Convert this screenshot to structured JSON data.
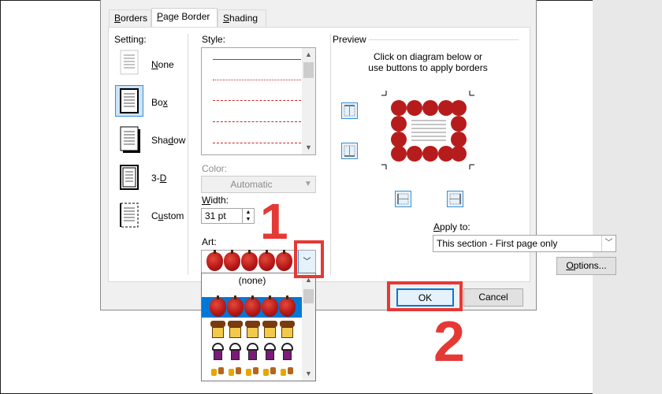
{
  "tabs": [
    {
      "label": "Borders",
      "underline": "B",
      "rest": "orders"
    },
    {
      "label": "Page Border",
      "underline": "P",
      "rest": "age Border"
    },
    {
      "label": "Shading",
      "underline": "S",
      "rest": "hading"
    }
  ],
  "setting": {
    "label": "Setting:",
    "options": [
      {
        "pre": "",
        "ul": "N",
        "post": "one"
      },
      {
        "pre": "Bo",
        "ul": "x",
        "post": ""
      },
      {
        "pre": "Sha",
        "ul": "d",
        "post": "ow"
      },
      {
        "pre": "3-",
        "ul": "D",
        "post": ""
      },
      {
        "pre": "C",
        "ul": "u",
        "post": "stom"
      }
    ]
  },
  "style": {
    "label": "Style:"
  },
  "color": {
    "label": "Color:",
    "value": "Automatic"
  },
  "width": {
    "label": "Width:",
    "value": "31 pt"
  },
  "art": {
    "label": "Art:",
    "options": [
      "(none)"
    ]
  },
  "preview": {
    "title": "Preview",
    "hint_line1": "Click on diagram below or",
    "hint_line2": "use buttons to apply borders"
  },
  "apply_to": {
    "label": "Apply to:",
    "value": "This section - First page only"
  },
  "buttons": {
    "options": "Options...",
    "ok": "OK",
    "cancel": "Cancel"
  },
  "annotations": {
    "step1": "1",
    "step2": "2"
  },
  "colors": {
    "highlight": "#e53935",
    "selection": "#0078d7",
    "accent": "#3a8fd6"
  }
}
